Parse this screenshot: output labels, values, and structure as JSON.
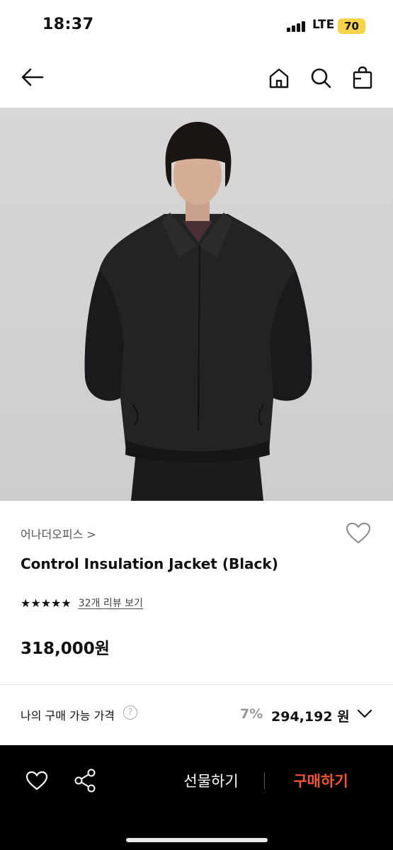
{
  "status_bar": {
    "time": "18:37",
    "network": "LTE",
    "battery": "70",
    "battery_color": "#f5d44b"
  },
  "nav": {
    "icons": [
      "back-arrow-icon",
      "home-icon",
      "search-icon",
      "shopping-bag-icon"
    ]
  },
  "product": {
    "image": "black insulation jacket worn by model on grey background",
    "brand": "어나더오피스 >",
    "name": "Control Insulation Jacket (Black)",
    "stars": "★★★★★",
    "rating": 5,
    "review_link": "32개 리뷰 보기",
    "price": "318,000원"
  },
  "my_price": {
    "label": "나의 구매 가능 가격",
    "help": "?",
    "discount_rate": "7%",
    "discount_price": "294,192 원"
  },
  "bottom_bar": {
    "gift_label": "선물하기",
    "buy_label": "구매하기",
    "buy_color": "#f2542d"
  }
}
